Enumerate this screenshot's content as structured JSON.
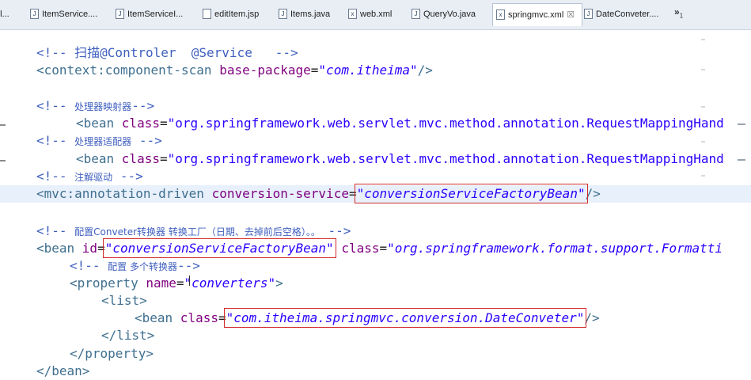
{
  "tabs": [
    {
      "label": "ol...",
      "icon": "file-icon"
    },
    {
      "label": "ItemService....",
      "icon": "java-file-icon"
    },
    {
      "label": "ItemServiceI...",
      "icon": "java-file-icon"
    },
    {
      "label": "editItem.jsp",
      "icon": "jsp-file-icon"
    },
    {
      "label": "Items.java",
      "icon": "java-file-icon"
    },
    {
      "label": "web.xml",
      "icon": "xml-file-icon"
    },
    {
      "label": "QueryVo.java",
      "icon": "java-file-icon"
    },
    {
      "label": "springmvc.xml",
      "icon": "xml-file-icon",
      "active": true,
      "close": "☒"
    },
    {
      "label": "DateConveter....",
      "icon": "java-file-icon"
    }
  ],
  "overflow": {
    "symbol": "»",
    "count": "1"
  },
  "code": {
    "l1_comment": "<!-- 扫描@Controler  @Service   -->",
    "l2_open": "<context:component-scan ",
    "l2_attr": "base-package",
    "l2_eq": "=",
    "l2_val": "\"com.itheima\"",
    "l2_close": "/>",
    "l4_comment_a": "<!-- ",
    "l4_comment_cn": "处理器映射器",
    "l4_comment_b": "-->",
    "l5_open": "<bean ",
    "l5_attr": "class",
    "l5_eq": "=",
    "l5_val": "\"org.springframework.web.servlet.mvc.method.annotation.RequestMappingHand",
    "l6_comment_a": "<!-- ",
    "l6_comment_cn": "处理器适配器",
    "l6_comment_b": " -->",
    "l7_open": "<bean ",
    "l7_attr": "class",
    "l7_eq": "=",
    "l7_val": "\"org.springframework.web.servlet.mvc.method.annotation.RequestMappingHand",
    "l8_comment_a": "<!-- ",
    "l8_comment_cn": "注解驱动",
    "l8_comment_b": " -->",
    "l9_open": "<mvc:annotation-driven ",
    "l9_attr": "conversion-service",
    "l9_eq": "=",
    "l9_val": "\"conversionServiceFactoryBean\"",
    "l9_close": "/>",
    "l11_comment_a": "<!-- ",
    "l11_comment_cn": "配置Conveter转换器 转换工厂（日期、去掉前后空格）。。",
    "l11_comment_b": " -->",
    "l12_open": "<bean ",
    "l12_attr1": "id",
    "l12_eq1": "=",
    "l12_val1": "\"conversionServiceFactoryBean\"",
    "l12_attr2": "class",
    "l12_eq2": "=",
    "l12_val2": "\"org.springframework.format.support.Formatti",
    "l13_comment_a": "<!-- ",
    "l13_comment_cn": "配置 多个转换器",
    "l13_comment_b": "-->",
    "l14_open": "<property ",
    "l14_attr": "name",
    "l14_eq": "=",
    "l14_val": "\"converters\"",
    "l14_close": ">",
    "l15_tag": "<list>",
    "l16_open": "<bean ",
    "l16_attr": "class",
    "l16_eq": "=",
    "l16_val": "\"com.itheima.springmvc.conversion.DateConveter\"",
    "l16_close": "/>",
    "l17_tag": "</list>",
    "l18_tag": "</property>",
    "l19_tag": "</bean>"
  },
  "colors": {
    "tag": "#3f6f8f",
    "attribute": "#7f007f",
    "value": "#2a00ff",
    "comment": "#3f5fbf",
    "highlight_box": "#d42a2a",
    "current_line": "#e8f0fb"
  }
}
